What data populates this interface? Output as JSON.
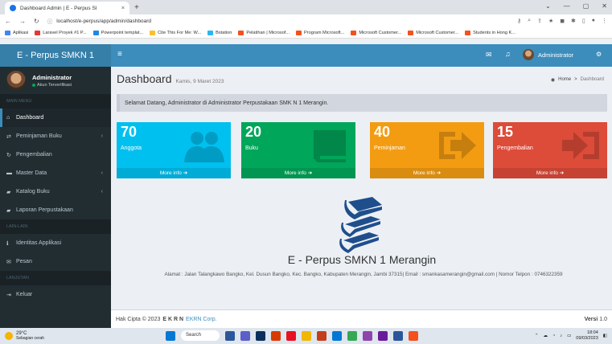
{
  "browser": {
    "tab_title": "Dashboard Admin | E - Perpus Sl",
    "tab_close": "×",
    "new_tab": "+",
    "url": "localhost/e-perpus/app/admin/dashboard",
    "bookmarks": [
      {
        "label": "Aplikasi",
        "color": "#4285f4"
      },
      {
        "label": "Laravel Proyek #1 P...",
        "color": "#e53935"
      },
      {
        "label": "Powerpoint templat...",
        "color": "#1e88e5"
      },
      {
        "label": "Cite This For Me: W...",
        "color": "#fbc02d"
      },
      {
        "label": "Bstation",
        "color": "#29b6f6"
      },
      {
        "label": "Pelatihan | Microsof...",
        "color": "#f4511e"
      },
      {
        "label": "Program Microsoft...",
        "color": "#f4511e"
      },
      {
        "label": "Microsoft Customer...",
        "color": "#f4511e"
      },
      {
        "label": "Microsoft Customer...",
        "color": "#f4511e"
      },
      {
        "label": "Students in Hong K...",
        "color": "#f4511e"
      }
    ]
  },
  "brand": {
    "title": "E - Perpus SMKN 1"
  },
  "topbar": {
    "user_name": "Administrator"
  },
  "user_panel": {
    "name": "Administrator",
    "status": "Akun Terverifikasi"
  },
  "sidebar": {
    "section_main": "MAIN MENU",
    "section_other": "LAIN-LAIN",
    "section_more": "LANJUTAN",
    "items": [
      {
        "label": "Dashboard",
        "icon": "home-icon",
        "glyph": "⌂",
        "arrow": ""
      },
      {
        "label": "Peminjaman Buku",
        "icon": "exchange-icon",
        "glyph": "⇄",
        "arrow": "‹"
      },
      {
        "label": "Pengembalian",
        "icon": "refresh-icon",
        "glyph": "↻",
        "arrow": ""
      },
      {
        "label": "Master Data",
        "icon": "folder-icon",
        "glyph": "▬",
        "arrow": "‹"
      },
      {
        "label": "Katalog Buku",
        "icon": "book-icon",
        "glyph": "▰",
        "arrow": "‹"
      },
      {
        "label": "Laporan Perpustakaan",
        "icon": "report-icon",
        "glyph": "▰",
        "arrow": ""
      },
      {
        "label": "Identitas Applikasi",
        "icon": "info-icon",
        "glyph": "ℹ",
        "arrow": ""
      },
      {
        "label": "Pesan",
        "icon": "envelope-icon",
        "glyph": "✉",
        "arrow": ""
      },
      {
        "label": "Keluar",
        "icon": "sign-out-icon",
        "glyph": "⇥",
        "arrow": ""
      }
    ]
  },
  "header": {
    "title": "Dashboard",
    "date": "Kamis, 9 Maret 2023",
    "breadcrumb_home": "Home",
    "breadcrumb_sep": ">",
    "breadcrumb_current": "Dashboard"
  },
  "callout": {
    "text": "Selamat Datang, Administrator di Administrator Perpustakaan SMK N 1 Merangin."
  },
  "boxes": [
    {
      "value": "70",
      "label": "Anggota",
      "more": "More info",
      "color": "#00c0ef",
      "icon": "users-icon"
    },
    {
      "value": "20",
      "label": "Buku",
      "more": "More info",
      "color": "#00a65a",
      "icon": "book-icon"
    },
    {
      "value": "40",
      "label": "Peminjaman",
      "more": "More info",
      "color": "#f39c12",
      "icon": "arrow-right-icon"
    },
    {
      "value": "15",
      "label": "Pengembalian",
      "more": "More info",
      "color": "#dd4b39",
      "icon": "sign-in-icon"
    }
  ],
  "center": {
    "title": "E - Perpus SMKN 1 Merangin",
    "address": "Alamat : Jalan Talangkawo Bangko, Kel. Dusun Bangko, Kec. Bangko, Kabupaten Merangin, Jambi 37315| Email : smankasamerangin@gmail.com | Nomor Telpon : 0746322359"
  },
  "footer": {
    "copyright": "Hak Cipta © 2023",
    "author": "E K R N",
    "company": "EKRN Corp.",
    "version_label": "Versi",
    "version": "1.0"
  },
  "taskbar": {
    "temp": "29°C",
    "weather": "Sebagian cerah",
    "search": "Search",
    "time": "18:04",
    "date": "09/03/2023"
  }
}
